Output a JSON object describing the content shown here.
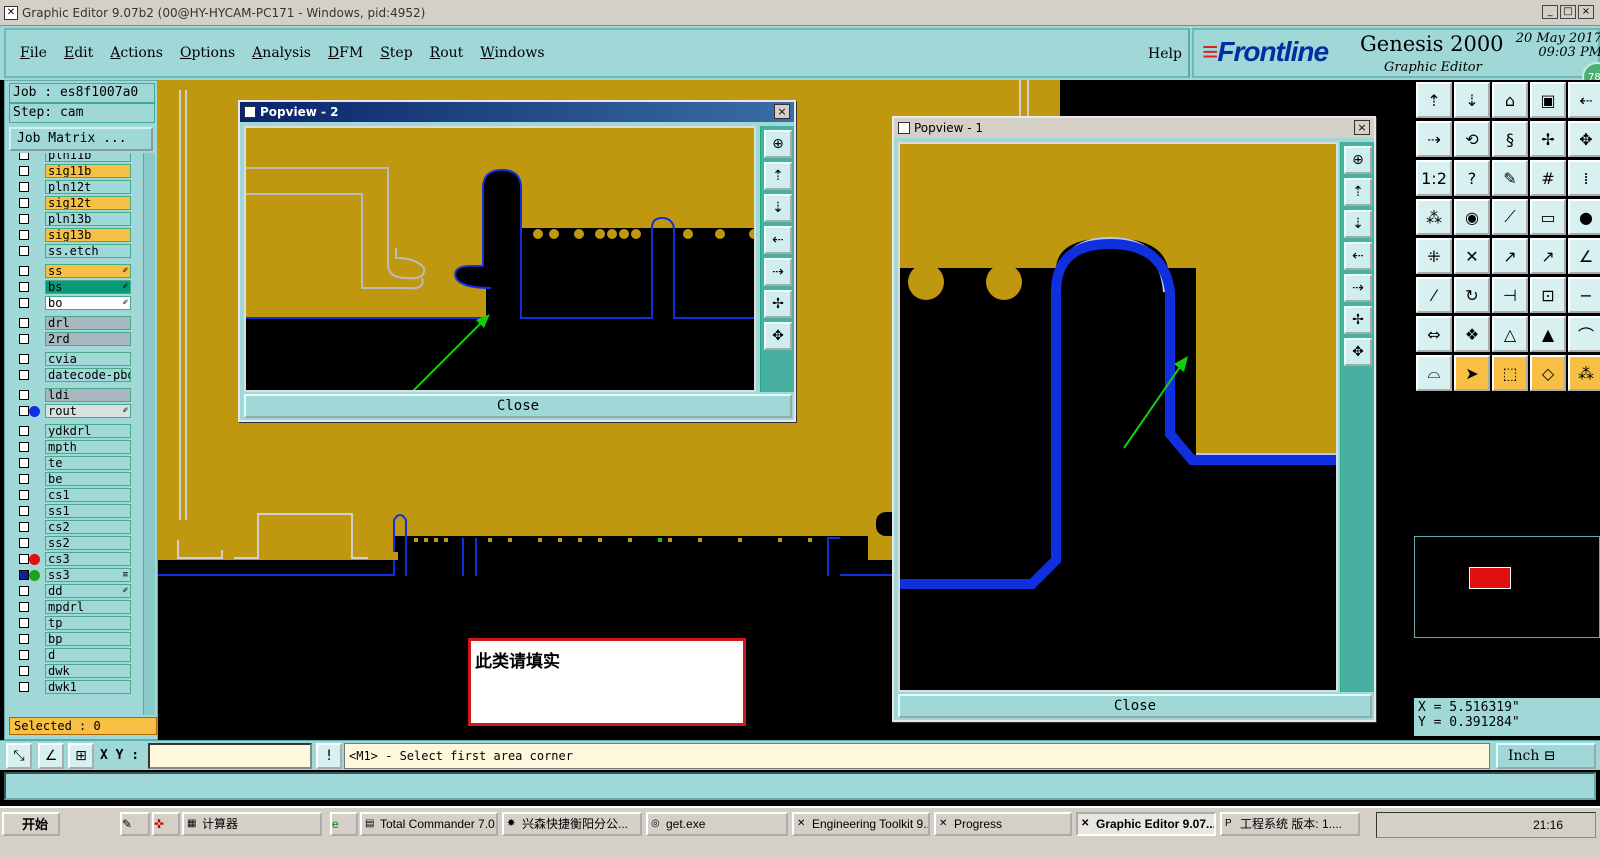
{
  "window": {
    "title": "Graphic Editor 9.07b2 (00@HY-HYCAM-PC171 - Windows, pid:4952)",
    "buttons": [
      "_",
      "□",
      "×"
    ]
  },
  "menu": {
    "items": [
      {
        "label": "File",
        "mn": "F",
        "rest": "ile"
      },
      {
        "label": "Edit",
        "mn": "E",
        "rest": "dit"
      },
      {
        "label": "Actions",
        "mn": "A",
        "rest": "ctions"
      },
      {
        "label": "Options",
        "mn": "O",
        "rest": "ptions"
      },
      {
        "label": "Analysis",
        "mn": "A",
        "rest": "nalysis"
      },
      {
        "label": "DFM",
        "mn": "D",
        "rest": "FM"
      },
      {
        "label": "Step",
        "mn": "S",
        "rest": "tep"
      },
      {
        "label": "Rout",
        "mn": "R",
        "rest": "out"
      },
      {
        "label": "Windows",
        "mn": "W",
        "rest": "indows"
      }
    ],
    "help": "Help"
  },
  "brand": {
    "logo": "Frontline",
    "product": "Genesis 2000",
    "subtitle": "Graphic Editor",
    "date": "20 May 2017",
    "time": "09:03 PM",
    "badge": "78"
  },
  "job": {
    "job_line": "Job : es8f1007a0",
    "step_line": "Step: cam",
    "matrix_button": "Job Matrix ...",
    "selected": "Selected : 0"
  },
  "layers": [
    {
      "name": "pln11b",
      "bg": "#a0d8d8"
    },
    {
      "name": "sig11b",
      "bg": "#f7c044"
    },
    {
      "name": "pln12t",
      "bg": "#a0d8d8"
    },
    {
      "name": "sig12t",
      "bg": "#f7c044"
    },
    {
      "name": "pln13b",
      "bg": "#a0d8d8"
    },
    {
      "name": "sig13b",
      "bg": "#f7c044"
    },
    {
      "name": "ss.etch",
      "bg": "#a0d8d8"
    },
    {
      "name": "ss",
      "bg": "#f7c044",
      "mark": "✐",
      "gap": true
    },
    {
      "name": "bs",
      "bg": "#0a9a7a",
      "mark": "✐"
    },
    {
      "name": "bo",
      "bg": "#ffffff",
      "mark": "✐"
    },
    {
      "name": "drl",
      "bg": "#a8b8c0",
      "gap": true
    },
    {
      "name": "2rd",
      "bg": "#a8b8c0"
    },
    {
      "name": "cvia",
      "bg": "#a0d8d8",
      "gap": true
    },
    {
      "name": "datecode-pbd",
      "bg": "#a0d8d8"
    },
    {
      "name": "ldi",
      "bg": "#a8b8c0",
      "gap": true
    },
    {
      "name": "rout",
      "bg": "#d8e0e0",
      "dot": "#1030e0",
      "mark": "✐"
    },
    {
      "name": "ydkdrl",
      "bg": "#a0d8d8",
      "gap": true
    },
    {
      "name": "mpth",
      "bg": "#a0d8d8"
    },
    {
      "name": "te",
      "bg": "#a0d8d8"
    },
    {
      "name": "be",
      "bg": "#a0d8d8"
    },
    {
      "name": "cs1",
      "bg": "#a0d8d8"
    },
    {
      "name": "ss1",
      "bg": "#a0d8d8"
    },
    {
      "name": "cs2",
      "bg": "#a0d8d8"
    },
    {
      "name": "ss2",
      "bg": "#a0d8d8"
    },
    {
      "name": "cs3",
      "bg": "#a0d8d8",
      "dot": "#e01010"
    },
    {
      "name": "ss3",
      "bg": "#a0d8d8",
      "dot": "#20a020",
      "checked": true,
      "mark": "≡"
    },
    {
      "name": "dd",
      "bg": "#a0d8d8",
      "mark": "✐"
    },
    {
      "name": "mpdrl",
      "bg": "#a0d8d8"
    },
    {
      "name": "tp",
      "bg": "#a0d8d8"
    },
    {
      "name": "bp",
      "bg": "#a0d8d8"
    },
    {
      "name": "d",
      "bg": "#a0d8d8"
    },
    {
      "name": "dwk",
      "bg": "#a0d8d8"
    },
    {
      "name": "dwk1",
      "bg": "#a0d8d8"
    }
  ],
  "popview2": {
    "title": "Popview - 2",
    "close": "Close"
  },
  "popview1": {
    "title": "Popview - 1",
    "close": "Close"
  },
  "note": {
    "text": "此类请填实"
  },
  "coords": {
    "x": "X =  5.516319\"",
    "y": "Y =  0.391284\""
  },
  "command": {
    "xy_label": "X Y :",
    "xy_value": "",
    "message": "<M1> - Select first area corner",
    "unit": "Inch"
  },
  "taskbar": {
    "start": "开始",
    "tasks": [
      "计算器",
      "Total Commander 7.0...",
      "兴森快捷衡阳分公...",
      "get.exe",
      "Engineering Toolkit 9....",
      "Progress",
      "Graphic Editor 9.07...",
      "工程系统  版本: 1...."
    ],
    "active_task": "Graphic Editor 9.07...",
    "clock": "21:16"
  },
  "colors": {
    "panel": "#a0d8d8",
    "copper": "#c09810",
    "rout": "#1030e0",
    "arrow": "#10d010"
  }
}
